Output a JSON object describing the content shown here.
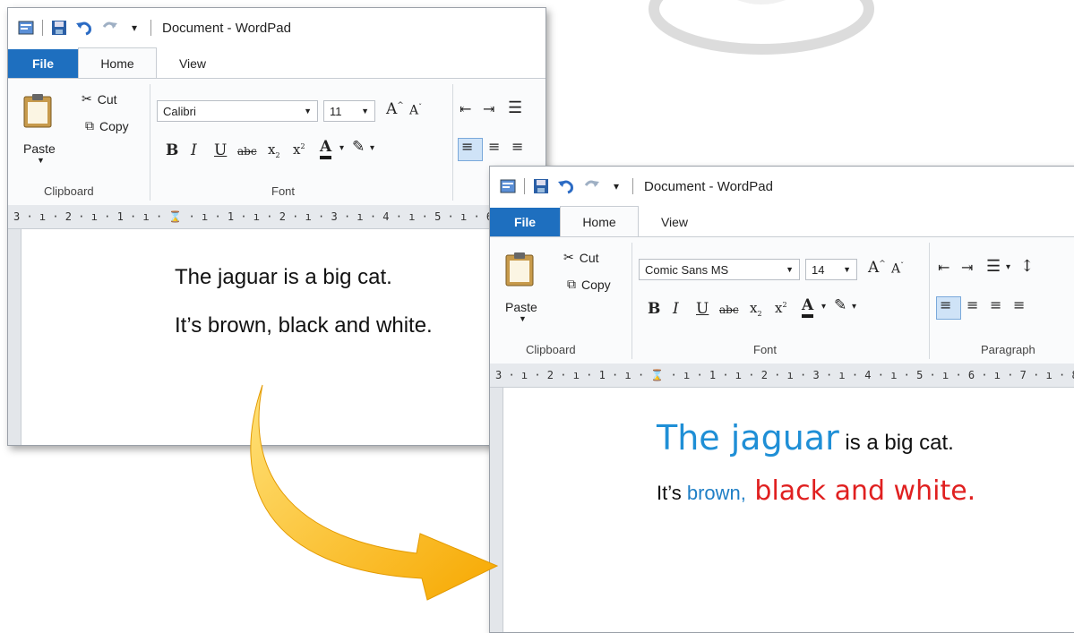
{
  "window_back": {
    "title": "Document - WordPad",
    "tabs": [
      "File",
      "Home",
      "View"
    ],
    "clipboard": {
      "paste": "Paste",
      "cut": "Cut",
      "copy": "Copy",
      "group": "Clipboard"
    },
    "font": {
      "family": "Calibri",
      "size": "11",
      "group": "Font"
    },
    "ruler": "3 · ı · 2 · ı · 1 · ı · ⌛ · ı · 1 · ı · 2 · ı · 3 · ı · 4 · ı · 5 · ı · 6",
    "document": {
      "line1": "The jaguar is a big cat.",
      "line2": "It’s brown, black and white."
    }
  },
  "window_front": {
    "title": "Document - WordPad",
    "tabs": [
      "File",
      "Home",
      "View"
    ],
    "clipboard": {
      "paste": "Paste",
      "cut": "Cut",
      "copy": "Copy",
      "group": "Clipboard"
    },
    "font": {
      "family": "Comic Sans MS",
      "size": "14",
      "group": "Font"
    },
    "paragraph_group": "Paragraph",
    "ruler": "3 · ı · 2 · ı · 1 · ı · ⌛ · ı · 1 · ı · 2 · ı · 3 · ı · 4 · ı · 5 · ı · 6 · ı · 7 · ı · 8 ·",
    "document": {
      "line1_part1": "The jaguar",
      "line1_part2": " is a big cat.",
      "line2_part1": "It’s ",
      "line2_part2": "brown,",
      "line2_part3": " black and white."
    }
  },
  "colors": {
    "file_tab": "#1e6fbf",
    "jaguar_blue": "#1f8fd6",
    "brown_blue": "#1f7fc6",
    "red_text": "#e02020",
    "arrow": "#ffb800"
  }
}
